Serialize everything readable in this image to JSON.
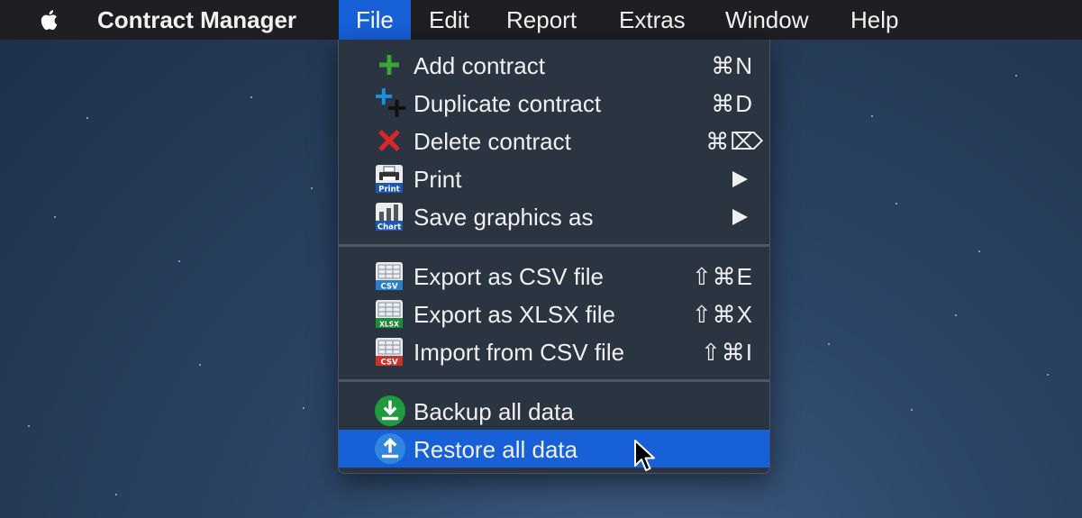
{
  "menubar": {
    "app_name": "Contract Manager",
    "items": [
      "File",
      "Edit",
      "Report",
      "Extras",
      "Window",
      "Help"
    ],
    "active": "File"
  },
  "file_menu": {
    "items": [
      {
        "label": "Add contract",
        "shortcut": "⌘N",
        "icon": "add-icon"
      },
      {
        "label": "Duplicate contract",
        "shortcut": "⌘D",
        "icon": "duplicate-icon"
      },
      {
        "label": "Delete contract",
        "shortcut": "⌘⌦",
        "icon": "delete-icon"
      },
      {
        "label": "Print",
        "submenu": true,
        "icon": "print-icon",
        "icon_text": "Print"
      },
      {
        "label": "Save graphics as",
        "submenu": true,
        "icon": "chart-icon",
        "icon_text": "Chart"
      },
      {
        "label": "Export as CSV file",
        "shortcut": "⇧⌘E",
        "icon": "csv-export-icon",
        "icon_text": "CSV"
      },
      {
        "label": "Export as XLSX file",
        "shortcut": "⇧⌘X",
        "icon": "xlsx-export-icon",
        "icon_text": "XLSX"
      },
      {
        "label": "Import from CSV file",
        "shortcut": "⇧⌘I",
        "icon": "csv-import-icon",
        "icon_text": "CSV"
      },
      {
        "label": "Backup all data",
        "icon": "backup-icon"
      },
      {
        "label": "Restore all data",
        "icon": "restore-icon",
        "highlighted": true
      }
    ]
  },
  "colors": {
    "menubar_bg": "#1d1f23",
    "menu_bg": "#2b3441",
    "highlight": "#1860d8",
    "add_green": "#3aa536",
    "delete_red": "#e0242b",
    "csv_blue": "#2a7fc7",
    "xlsx_green": "#1f8a3a",
    "import_red": "#c8342c"
  }
}
